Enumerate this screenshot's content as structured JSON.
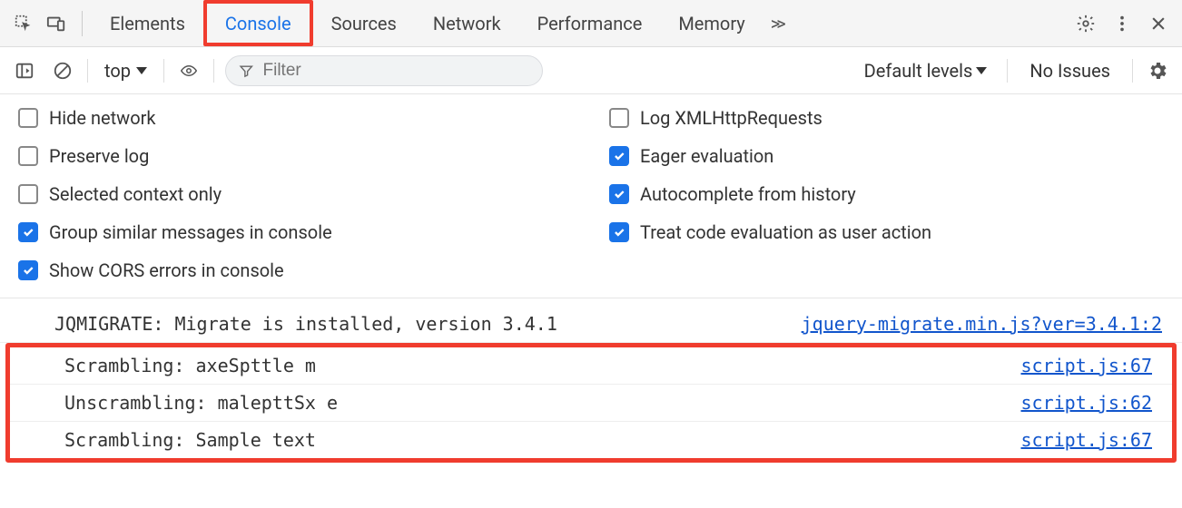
{
  "tabs": {
    "elements": "Elements",
    "console": "Console",
    "sources": "Sources",
    "network": "Network",
    "performance": "Performance",
    "memory": "Memory"
  },
  "subbar": {
    "context": "top",
    "filter_placeholder": "Filter",
    "levels": "Default levels",
    "no_issues": "No Issues"
  },
  "options": {
    "hide_network": "Hide network",
    "preserve_log": "Preserve log",
    "selected_context": "Selected context only",
    "group_similar": "Group similar messages in console",
    "show_cors": "Show CORS errors in console",
    "log_xhr": "Log XMLHttpRequests",
    "eager_eval": "Eager evaluation",
    "autocomplete": "Autocomplete from history",
    "treat_code": "Treat code evaluation as user action"
  },
  "log": {
    "row0": {
      "msg": "JQMIGRATE: Migrate is installed, version 3.4.1",
      "src": "jquery-migrate.min.js?ver=3.4.1:2"
    },
    "row1": {
      "msg": "Scrambling: axeSpttle m",
      "src": "script.js:67"
    },
    "row2": {
      "msg": "Unscrambling: malepttSx e",
      "src": "script.js:62"
    },
    "row3": {
      "msg": "Scrambling: Sample text",
      "src": "script.js:67"
    }
  }
}
